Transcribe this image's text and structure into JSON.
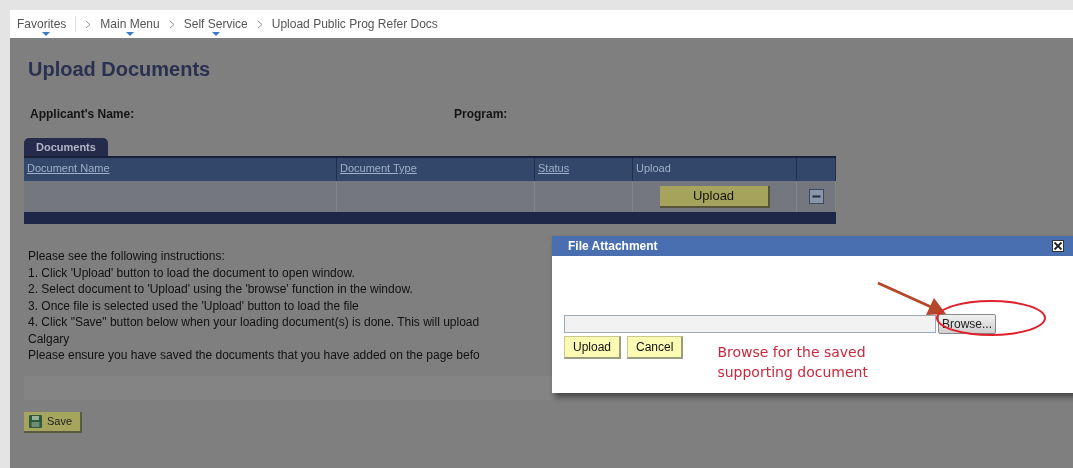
{
  "breadcrumb": [
    {
      "label": "Favorites",
      "has_menu": true
    },
    {
      "label": "Main Menu",
      "has_menu": true
    },
    {
      "label": "Self Service",
      "has_menu": true
    },
    {
      "label": "Upload Public Prog Refer Docs",
      "has_menu": false
    }
  ],
  "page_title": "Upload Documents",
  "fields": [
    {
      "label": "Applicant's Name:"
    },
    {
      "label": "Program:"
    }
  ],
  "tabs": [
    {
      "label": "Documents",
      "selected": true
    }
  ],
  "table": {
    "columns": [
      {
        "label": "Document Name",
        "link": true
      },
      {
        "label": "Document Type",
        "link": true
      },
      {
        "label": "Status",
        "link": true
      },
      {
        "label": "Upload",
        "link": false
      }
    ],
    "rows": [
      {
        "upload_button": "Upload"
      }
    ]
  },
  "instructions": [
    "Please see the following instructions:",
    "1. Click 'Upload' button to load the document to open window.",
    "2. Select document to 'Upload' using the 'browse' function in the window.",
    "3. Once file is selected used the 'Upload' button to load the file",
    "4. Click \"Save\" button below when your loading document(s) is done. This will upload",
    "Calgary",
    "Please ensure you have saved the documents that you have added on the page befo"
  ],
  "save_button": "Save",
  "dialog": {
    "title": "File Attachment",
    "browse_button": "Browse...",
    "buttons": [
      "Upload",
      "Cancel"
    ],
    "annotation": [
      "Browse for the saved",
      "supporting document"
    ]
  }
}
